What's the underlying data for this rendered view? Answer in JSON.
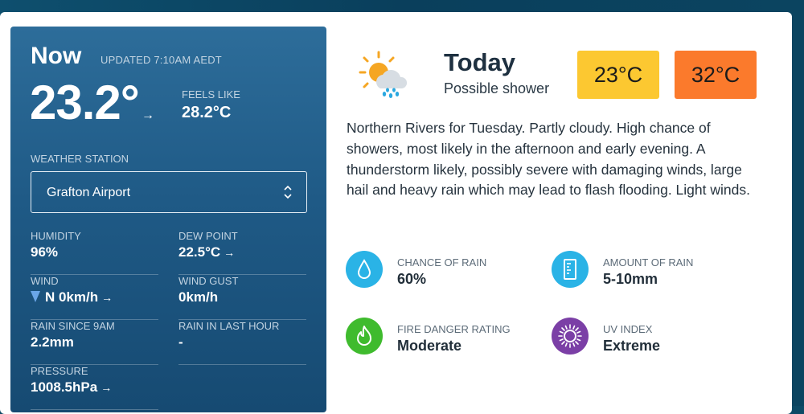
{
  "now": {
    "title": "Now",
    "updated": "UPDATED 7:10AM AEDT",
    "temperature": "23.2°",
    "temp_trend_arrow": "→",
    "feels_like_label": "FEELS LIKE",
    "feels_like_value": "28.2°C",
    "station_label": "WEATHER STATION",
    "station_value": "Grafton Airport",
    "stats": {
      "humidity": {
        "label": "HUMIDITY",
        "value": "96%"
      },
      "dew_point": {
        "label": "DEW POINT",
        "value": "22.5°C"
      },
      "wind": {
        "label": "WIND",
        "value": "N 0km/h"
      },
      "wind_gust": {
        "label": "WIND GUST",
        "value": "0km/h"
      },
      "rain_since_9am": {
        "label": "RAIN SINCE 9AM",
        "value": "2.2mm"
      },
      "rain_last_hour": {
        "label": "RAIN IN LAST HOUR",
        "value": "-"
      },
      "pressure": {
        "label": "PRESSURE",
        "value": "1008.5hPa"
      }
    },
    "arrow": "→"
  },
  "today": {
    "icon": "sun-behind-rain-cloud-icon",
    "title": "Today",
    "summary": "Possible shower",
    "min_temp": "23°C",
    "max_temp": "32°C",
    "forecast": "Northern Rivers for Tuesday. Partly cloudy. High chance of showers, most likely in the afternoon and early evening. A thunderstorm likely, possibly severe with damaging winds, large hail and heavy rain which may lead to flash flooding. Light winds.",
    "metrics": {
      "chance_of_rain": {
        "label": "CHANCE OF RAIN",
        "value": "60%",
        "icon": "raindrop-icon",
        "color": "#2ab3e6"
      },
      "amount_of_rain": {
        "label": "AMOUNT OF RAIN",
        "value": "5-10mm",
        "icon": "rain-gauge-icon",
        "color": "#2ab3e6"
      },
      "fire_danger": {
        "label": "FIRE DANGER RATING",
        "value": "Moderate",
        "icon": "flame-icon",
        "color": "#3fbb2e"
      },
      "uv_index": {
        "label": "UV INDEX",
        "value": "Extreme",
        "icon": "uv-sun-icon",
        "color": "#7b3fa6"
      }
    }
  },
  "colors": {
    "panel": "#1f5a86",
    "min_temp_bg": "#fcc831",
    "max_temp_bg": "#fb7a2c"
  }
}
